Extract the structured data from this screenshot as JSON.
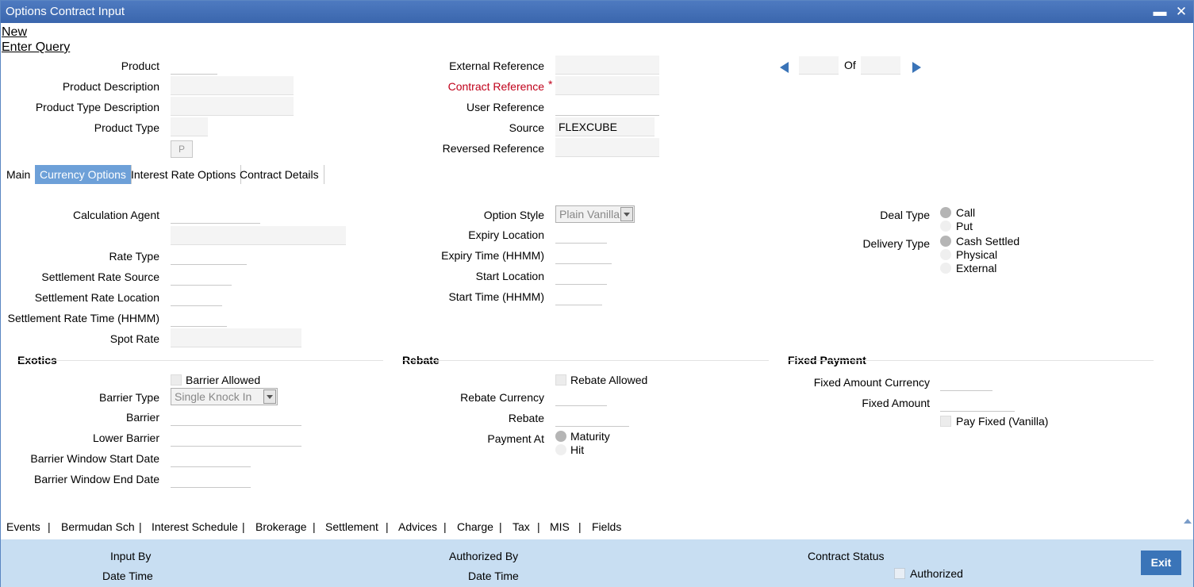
{
  "window": {
    "title": "Options Contract Input",
    "minimize": "▬",
    "close": "✕"
  },
  "links": {
    "new": "New",
    "enter_query": "Enter Query"
  },
  "header": {
    "product": "Product",
    "product_description": "Product Description",
    "product_type_description": "Product Type Description",
    "product_type": "Product Type",
    "p_button": "P",
    "external_reference": "External Reference",
    "contract_reference": "Contract Reference",
    "required_mark": "*",
    "user_reference": "User Reference",
    "source": "Source",
    "source_value": "FLEXCUBE",
    "reversed_reference": "Reversed Reference",
    "of": "Of"
  },
  "tabs": [
    {
      "label": "Main"
    },
    {
      "label": "Currency Options"
    },
    {
      "label": "Interest Rate Options"
    },
    {
      "label": "Contract Details"
    }
  ],
  "currency_options": {
    "calculation_agent": "Calculation Agent",
    "rate_type": "Rate Type",
    "settlement_rate_source": "Settlement Rate Source",
    "settlement_rate_location": "Settlement Rate Location",
    "settlement_rate_time": "Settlement Rate Time (HHMM)",
    "spot_rate": "Spot Rate",
    "option_style": "Option Style",
    "option_style_value": "Plain Vanilla",
    "expiry_location": "Expiry Location",
    "expiry_time": "Expiry Time (HHMM)",
    "start_location": "Start Location",
    "start_time": "Start Time (HHMM)",
    "deal_type": "Deal Type",
    "deal_call": "Call",
    "deal_put": "Put",
    "delivery_type": "Delivery Type",
    "delivery_cash": "Cash Settled",
    "delivery_physical": "Physical",
    "delivery_external": "External"
  },
  "exotics": {
    "title": "Exotics",
    "barrier_allowed": "Barrier Allowed",
    "barrier_type": "Barrier Type",
    "barrier_type_value": "Single Knock In",
    "barrier": "Barrier",
    "lower_barrier": "Lower Barrier",
    "window_start": "Barrier Window Start Date",
    "window_end": "Barrier Window End Date"
  },
  "rebate": {
    "title": "Rebate",
    "rebate_allowed": "Rebate Allowed",
    "rebate_currency": "Rebate Currency",
    "rebate": "Rebate",
    "payment_at": "Payment At",
    "maturity": "Maturity",
    "hit": "Hit"
  },
  "fixed_payment": {
    "title": "Fixed Payment",
    "fixed_amount_currency": "Fixed Amount Currency",
    "fixed_amount": "Fixed Amount",
    "pay_fixed": "Pay Fixed (Vanilla)"
  },
  "bottom_links": [
    "Events",
    "Bermudan Sch",
    "Interest Schedule",
    "Brokerage",
    "Settlement",
    "Advices",
    "Charge",
    "Tax",
    "MIS",
    "Fields"
  ],
  "separator": "|",
  "footer": {
    "input_by": "Input By",
    "date_time_1": "Date Time",
    "authorized_by": "Authorized By",
    "date_time_2": "Date Time",
    "contract_status": "Contract Status",
    "authorized": "Authorized",
    "exit": "Exit"
  },
  "colors": {
    "titlebar": "#3a66ad",
    "tab_active": "#6da0d8",
    "footer": "#c8def2",
    "exit_button": "#3a74b8",
    "required": "#c0001a"
  }
}
